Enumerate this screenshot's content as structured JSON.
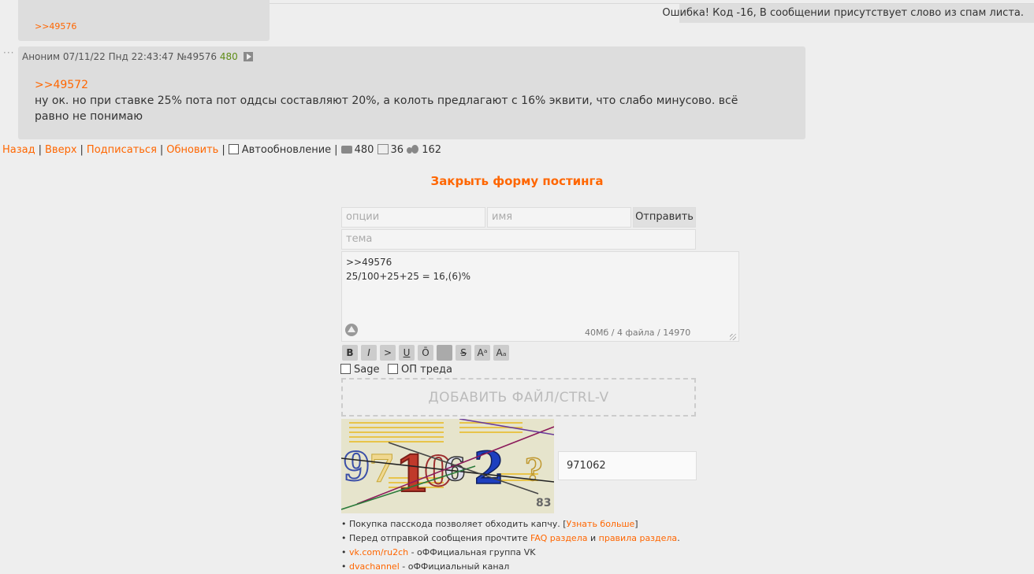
{
  "previous_post": {
    "reply_link": ">>49576"
  },
  "error_toast": {
    "text": "Ошибка! Код -16, В сообщении присутствует слово из спам листа."
  },
  "post": {
    "author": "Аноним",
    "datetime": "07/11/22 Пнд 22:43:47",
    "number": "№49576",
    "post_count": "480",
    "quote_link": ">>49572",
    "text": "ну ок. но при ставке 25% пота пот оддсы составляют 20%, а колоть предлагают с 16% эквити, что слабо минусово. всё равно не понимаю"
  },
  "thread_nav": {
    "back": "Назад",
    "top": "Вверх",
    "subscribe": "Подписаться",
    "refresh": "Обновить",
    "autorefresh": "Автообновление",
    "posts_count": "480",
    "images_count": "36",
    "posters_count": "162"
  },
  "form": {
    "close_label": "Закрыть форму постинга",
    "options_placeholder": "опции",
    "name_placeholder": "имя",
    "send_label": "Отправить",
    "subject_placeholder": "тема",
    "message": ">>49576\n25/100+25+25 = 16,(6)%",
    "limits": "40Мб  /  4 файла  /  14970",
    "format_buttons": [
      "B",
      "I",
      ">",
      "U",
      "Ō",
      "",
      "S",
      "Aᵃ",
      "Aₐ"
    ],
    "sage_label": "Sage",
    "op_label": "ОП треда",
    "add_file_label": "ДОБАВИТЬ ФАЙЛ/CTRL-V",
    "captcha_value": "971062",
    "captcha_corner_number": "83"
  },
  "notes": {
    "passcode_text": "Покупка пасскода позволяет обходить капчу. [",
    "passcode_link": "Узнать больше",
    "passcode_end": "]",
    "faq_text": "Перед отправкой сообщения прочтите ",
    "faq_link": "FAQ раздела",
    "and": " и ",
    "rules_link": "правила раздела",
    "faq_end": ".",
    "vk_link": "vk.com/ru2ch",
    "vk_text": " - оФФициальная группа VK",
    "channel_link": "dvachannel",
    "channel_text": " - оФФициальный канал"
  }
}
